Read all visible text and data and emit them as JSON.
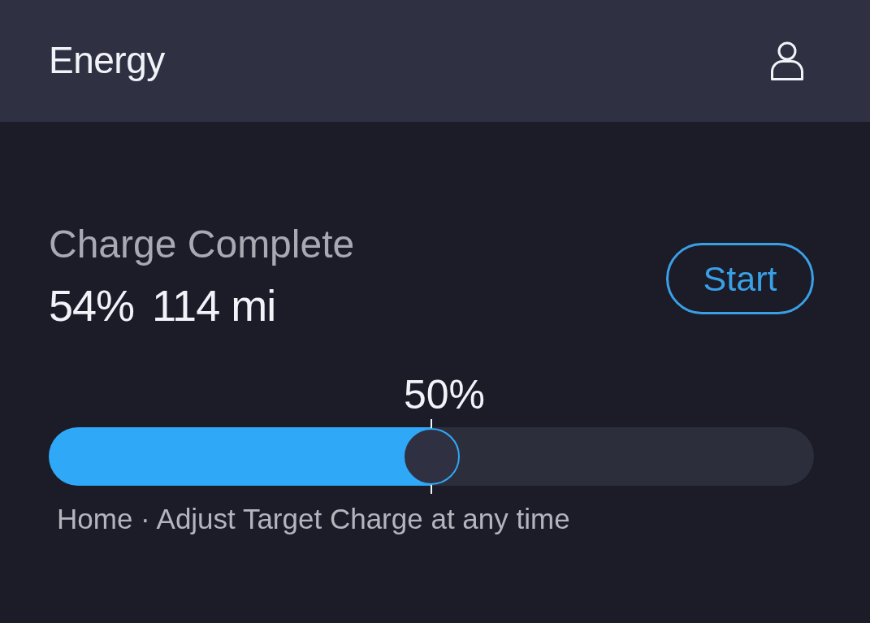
{
  "header": {
    "title": "Energy"
  },
  "charge": {
    "status": "Charge Complete",
    "percent": "54%",
    "range": "114 mi",
    "button": "Start"
  },
  "target": {
    "label": "50%",
    "level": 0.5,
    "note": "Home · Adjust Target Charge at any time"
  }
}
